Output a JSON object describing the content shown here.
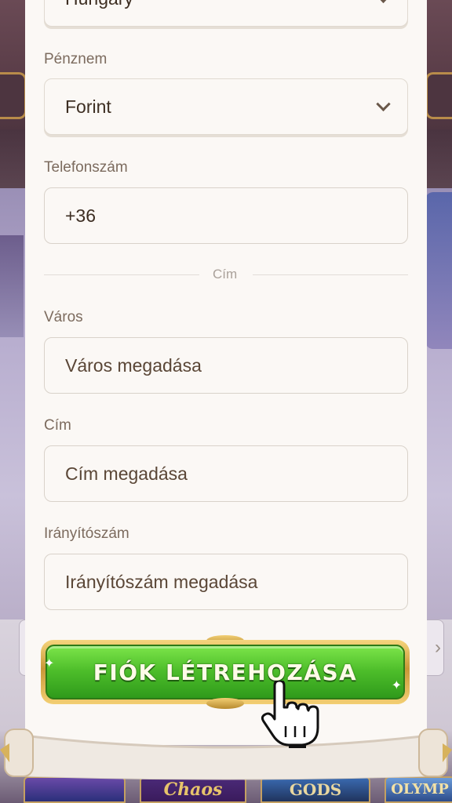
{
  "form": {
    "country_value": "Hungary",
    "currency_label": "Pénznem",
    "currency_value": "Forint",
    "phone_label": "Telefonszám",
    "phone_value": "+36",
    "address_divider": "Cím",
    "city_label": "Város",
    "city_placeholder": "Város megadása",
    "address_label": "Cím",
    "address_placeholder": "Cím megadása",
    "zip_label": "Irányítószám",
    "zip_placeholder": "Irányítószám megadása"
  },
  "cta": {
    "label": "FIÓK LÉTREHOZÁSA"
  },
  "background": {
    "thumbnails": [
      "",
      "Chaos",
      "GODS",
      "OLYMP"
    ]
  },
  "icons": {
    "select_chevron": "chevron-down-icon",
    "cursor": "pointing-hand-icon"
  },
  "colors": {
    "panel": "#fbf8f5",
    "cta_green": "#4dbd2a",
    "cta_gold": "#c89838",
    "label": "#7c6b5e"
  }
}
